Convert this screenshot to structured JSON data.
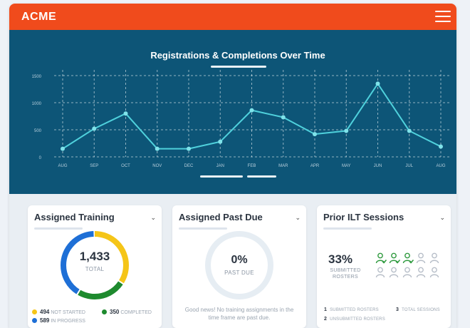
{
  "header": {
    "logo": "ACME"
  },
  "colors": {
    "header_bg": "#f04b1c",
    "hero_bg": "#0d5577",
    "line": "#4fd1dc",
    "not_started": "#f5c518",
    "completed": "#1e8a2e",
    "in_progress": "#1e6fd6",
    "submitted_person": "#2f9a3f",
    "unsubmitted_person": "#b7bec8"
  },
  "chart_data": {
    "type": "line",
    "title": "Registrations & Completions Over Time",
    "categories": [
      "AUG",
      "SEP",
      "OCT",
      "NOV",
      "DEC",
      "JAN",
      "FEB",
      "MAR",
      "APR",
      "MAY",
      "JUN",
      "JUL",
      "AUG"
    ],
    "values": [
      150,
      520,
      800,
      150,
      150,
      280,
      860,
      730,
      420,
      480,
      1350,
      480,
      190
    ],
    "yticks": [
      0,
      500,
      1000,
      1500
    ],
    "ylim": [
      0,
      1500
    ],
    "grid": true,
    "xlabel": "",
    "ylabel": ""
  },
  "cards": {
    "assigned": {
      "title": "Assigned Training",
      "total_value": "1,433",
      "total_label": "TOTAL",
      "segments": [
        {
          "key": "not_started",
          "value": 494,
          "value_text": "494",
          "label": "NOT STARTED"
        },
        {
          "key": "completed",
          "value": 350,
          "value_text": "350",
          "label": "COMPLETED"
        },
        {
          "key": "in_progress",
          "value": 589,
          "value_text": "589",
          "label": "IN PROGRESS"
        }
      ]
    },
    "past_due": {
      "title": "Assigned Past Due",
      "value": "0%",
      "label": "PAST DUE",
      "message": "Good news! No training assignments in the time frame are past due."
    },
    "ilt": {
      "title": "Prior ILT Sessions",
      "percent": "33%",
      "label_line1": "SUBMITTED",
      "label_line2": "ROSTERS",
      "submitted_icons": 3,
      "total_icons": 10,
      "submitted_count": "1",
      "submitted_label": "SUBMITTED ROSTERS",
      "total_sessions_count": "3",
      "total_sessions_label": "TOTAL SESSIONS",
      "unsubmitted_count": "2",
      "unsubmitted_label": "UNSUBMITTED ROSTERS"
    }
  }
}
